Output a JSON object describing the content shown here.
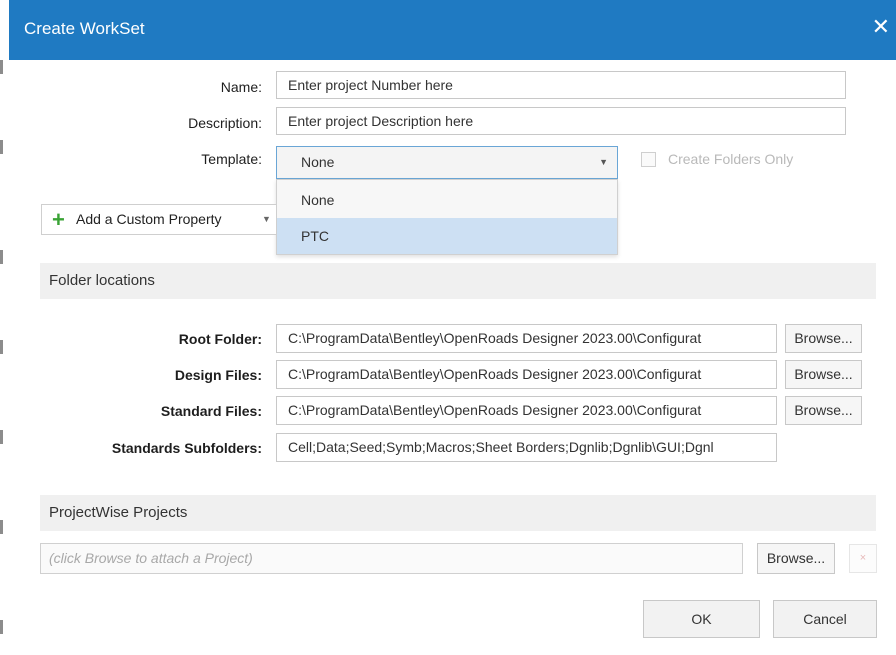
{
  "title": "Create WorkSet",
  "close_icon": "close-icon",
  "fields": {
    "name_label": "Name:",
    "name_value": "Enter project Number here",
    "description_label": "Description:",
    "description_value": "Enter project Description here",
    "template_label": "Template:",
    "template_value": "None",
    "template_options": [
      "None",
      "PTC"
    ],
    "template_highlighted": "PTC",
    "create_folders_only": "Create Folders Only"
  },
  "add_custom_property": "Add a Custom Property",
  "folder_locations": {
    "header": "Folder locations",
    "root_label": "Root Folder:",
    "root_value": "C:\\ProgramData\\Bentley\\OpenRoads Designer 2023.00\\Configurat",
    "design_label": "Design Files:",
    "design_value": "C:\\ProgramData\\Bentley\\OpenRoads Designer 2023.00\\Configurat",
    "standard_label": "Standard Files:",
    "standard_value": "C:\\ProgramData\\Bentley\\OpenRoads Designer 2023.00\\Configurat",
    "subfolders_label": "Standards Subfolders:",
    "subfolders_value": "Cell;Data;Seed;Symb;Macros;Sheet Borders;Dgnlib;Dgnlib\\GUI;Dgnl",
    "browse": "Browse..."
  },
  "projectwise": {
    "header": "ProjectWise Projects",
    "placeholder": "(click Browse to attach a Project)",
    "browse": "Browse...",
    "remove_symbol": "×"
  },
  "buttons": {
    "ok": "OK",
    "cancel": "Cancel"
  },
  "colors": {
    "titlebar": "#1f7ac2",
    "selected_option": "#cde0f3",
    "plus_green": "#3aa335"
  }
}
